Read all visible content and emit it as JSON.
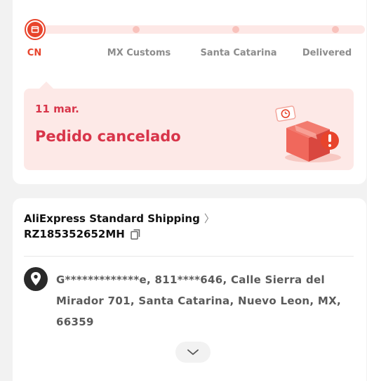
{
  "progress": {
    "stops": [
      {
        "label": "CN",
        "active": true
      },
      {
        "label": "MX Customs",
        "active": false
      },
      {
        "label": "Santa Catarina",
        "active": false
      },
      {
        "label": "Delivered",
        "active": false
      }
    ]
  },
  "status": {
    "date": "11 mar.",
    "title": "Pedido cancelado"
  },
  "shipping": {
    "method": "AliExpress Standard Shipping",
    "tracking_number": "RZ185352652MH"
  },
  "address": {
    "text": "G*************e, 811****646, Calle Sierra del Mirador 701, Santa Catarina, Nuevo Leon, MX, 66359"
  },
  "icons": {
    "current_stop": "package-box-icon",
    "copy": "copy-icon",
    "location": "location-pin-icon",
    "expand": "chevron-down-icon",
    "method_link": "chevron-right-icon"
  },
  "colors": {
    "accent": "#e8442c",
    "status_text": "#d8354a",
    "status_bg": "#fde9e7"
  }
}
